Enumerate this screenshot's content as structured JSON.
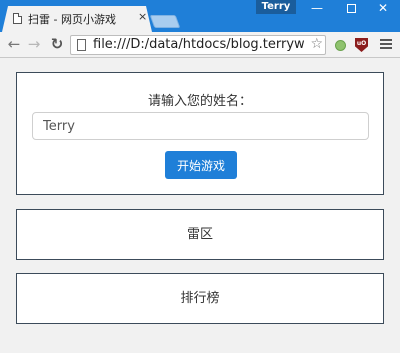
{
  "browser": {
    "tab_title": "扫雷 - 网页小游戏",
    "tab_close": "×",
    "profile_name": "Terry",
    "url": "file:///D:/data/htdocs/blog.terrywh.net",
    "extension_badge": "uO",
    "minimize_glyph": "—",
    "close_glyph": "✕"
  },
  "login": {
    "prompt": "请输入您的姓名：",
    "name_value": "Terry",
    "start_button": "开始游戏"
  },
  "panels": {
    "mines": "雷区",
    "ranking": "排行榜"
  },
  "colors": {
    "accent": "#1f7fd8",
    "panel_border": "#3c4b5a"
  }
}
